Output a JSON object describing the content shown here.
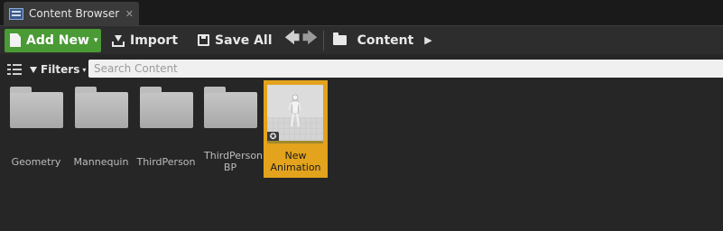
{
  "tab": {
    "title": "Content Browser",
    "close_glyph": "✕",
    "icon": "content-browser-icon"
  },
  "toolbar": {
    "add_new_label": "Add New",
    "import_label": "Import",
    "save_all_label": "Save All",
    "path_root": "Content",
    "back_glyph": "🡄",
    "forward_glyph": "🡆",
    "caret_glyph": "▾",
    "path_caret": "▶"
  },
  "filterbar": {
    "filters_label": "Filters",
    "search_placeholder": "Search Content"
  },
  "assets": [
    {
      "label": "Geometry",
      "type": "folder"
    },
    {
      "label": "Mannequin",
      "type": "folder"
    },
    {
      "label": "ThirdPerson",
      "type": "folder"
    },
    {
      "label": "ThirdPerson BP",
      "type": "folder"
    },
    {
      "label": "New Animation",
      "type": "animation",
      "selected": true,
      "badge_glyph": "✪"
    }
  ],
  "colors": {
    "add_new_green": "#4a9a35",
    "selection_gold": "#e3a31c",
    "background": "#262626"
  }
}
